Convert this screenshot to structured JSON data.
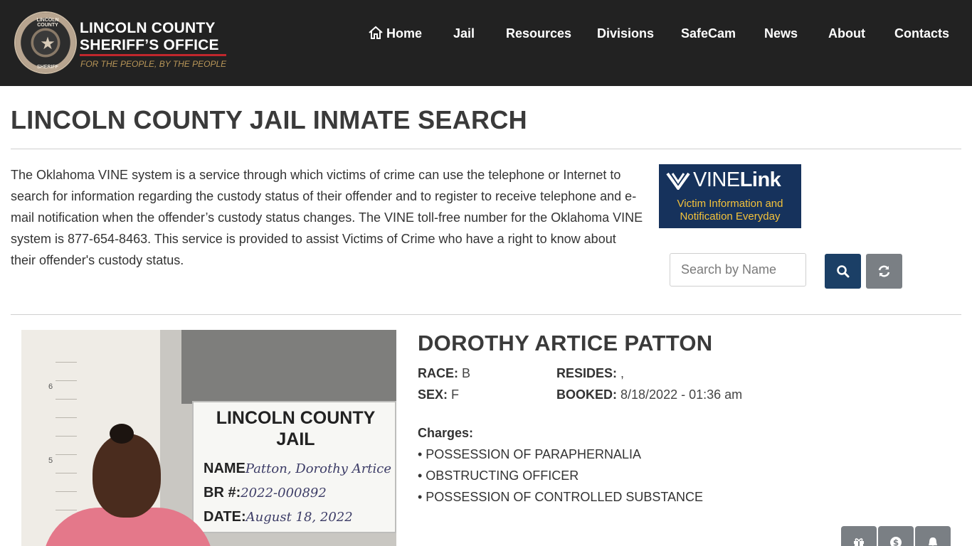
{
  "brand": {
    "line1": "LINCOLN COUNTY",
    "line2": "SHERIFF’S OFFICE",
    "tagline": "FOR THE PEOPLE, BY THE PEOPLE",
    "badge_top": "LINCOLN COUNTY",
    "badge_bottom": "SHERIFF"
  },
  "nav": {
    "home": "Home",
    "jail": "Jail",
    "resources": "Resources",
    "divisions": "Divisions",
    "safecam": "SafeCam",
    "news": "News",
    "about": "About",
    "contacts": "Contacts"
  },
  "page": {
    "title": "LINCOLN COUNTY JAIL INMATE SEARCH",
    "intro": "The Oklahoma VINE system is a service through which victims of crime can use the telephone or Internet to search for information regarding the custody status of their offender and to register to receive telephone and e-mail notification when the offender’s custody status changes. The VINE toll-free number for the Oklahoma VINE system is 877-654-8463. This service is provided to assist Victims of Crime who have a right to know about their offender's custody status."
  },
  "vine": {
    "word_a": "VINE",
    "word_b": "Link",
    "sub1": "Victim Information and",
    "sub2": "Notification Everyday"
  },
  "search": {
    "placeholder": "Search by Name",
    "value": ""
  },
  "inmate": {
    "name": "DOROTHY ARTICE PATTON",
    "race_label": "RACE:",
    "race": "B",
    "sex_label": "SEX:",
    "sex": "F",
    "resides_label": "RESIDES:",
    "resides": ",",
    "booked_label": "BOOKED:",
    "booked": "8/18/2022 - 01:36 am",
    "charges_label": "Charges:",
    "charges": [
      "• POSSESSION OF PARAPHERNALIA",
      "• OBSTRUCTING OFFICER",
      "• POSSESSION OF CONTROLLED SUBSTANCE"
    ]
  },
  "photo": {
    "sign_title1": "LINCOLN COUNTY",
    "sign_title2": "JAIL",
    "name_label": "NAME",
    "name_value": "Patton, Dorothy Artice",
    "br_label": "BR #:",
    "br_value": "2022-000892",
    "date_label": "DATE:",
    "date_value": "August 18, 2022",
    "scale6": "6",
    "scale5": "5"
  },
  "icons": {
    "home": "home-icon",
    "search": "search-icon",
    "reset": "refresh-icon",
    "gift": "gift-icon",
    "money": "dollar-icon",
    "bell": "bell-icon"
  },
  "colors": {
    "header_bg": "#222222",
    "brand_red": "#c0272d",
    "tagline_gold": "#b89658",
    "vine_navy": "#16325c",
    "vine_gold": "#f4c23a",
    "search_btn": "#1b3f66",
    "secondary_btn": "#7a7f84"
  }
}
